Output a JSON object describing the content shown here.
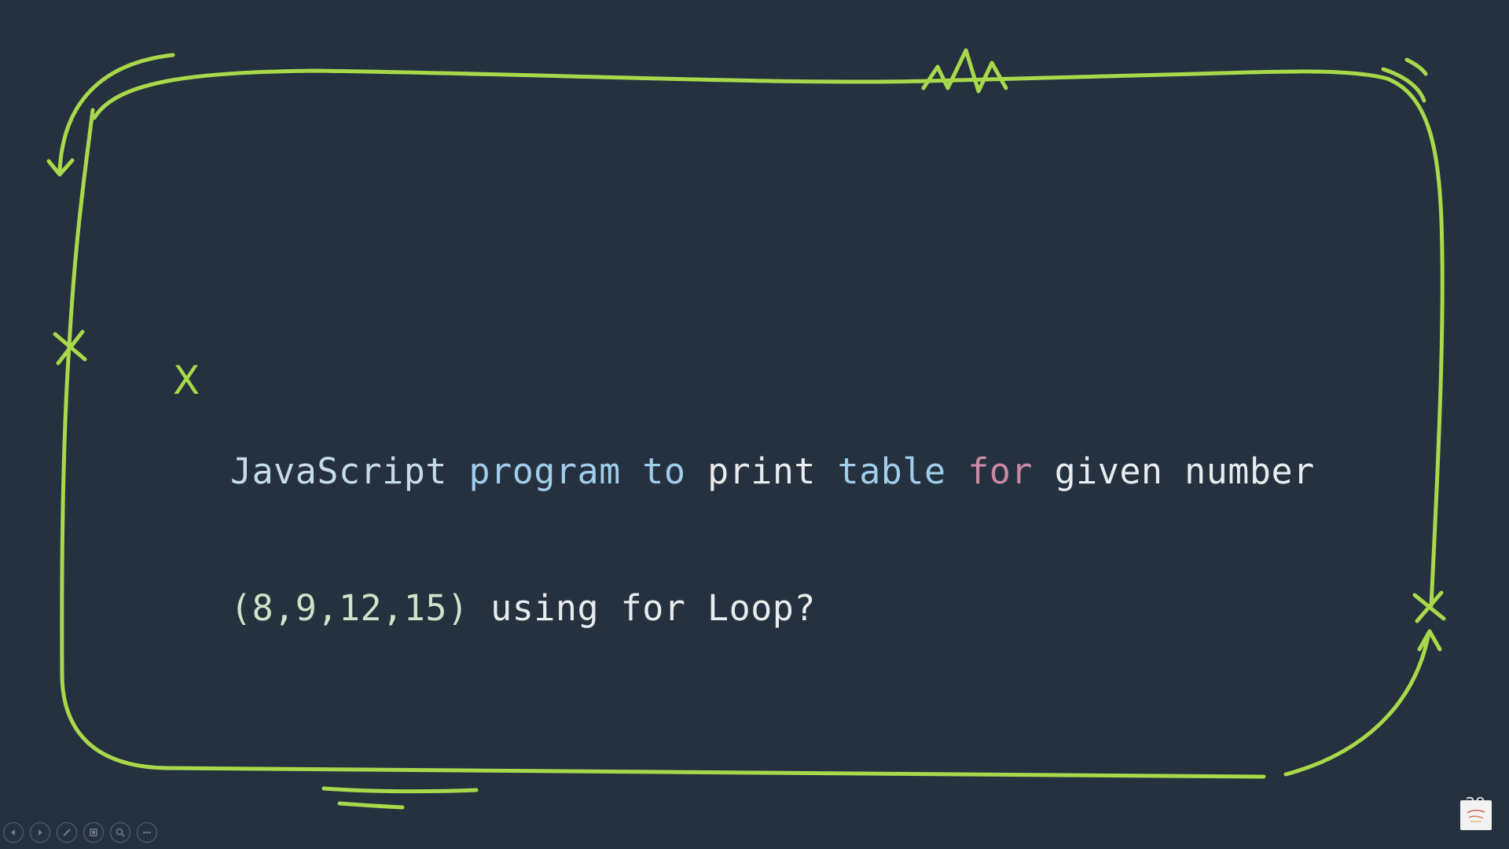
{
  "slide": {
    "bullet": "X",
    "question_line1": {
      "t1": "JavaScript",
      "t2": "program",
      "t3": "to",
      "t4": "print",
      "t5": "table",
      "t6": "for",
      "t7": "given number"
    },
    "question_line2": {
      "t1": "(8,9,12,15)",
      "t2": "using for Loop?"
    },
    "page_number": "29"
  },
  "toolbar": {
    "buttons": [
      {
        "icon": "previous-icon"
      },
      {
        "icon": "next-icon"
      },
      {
        "icon": "pen-icon"
      },
      {
        "icon": "slides-grid-icon"
      },
      {
        "icon": "zoom-icon"
      },
      {
        "icon": "more-options-icon"
      }
    ]
  },
  "colors": {
    "background": "#263140",
    "frame": "#a8d94a",
    "keyword_pink": "#c989a3",
    "text_blue": "#9fcdea"
  }
}
